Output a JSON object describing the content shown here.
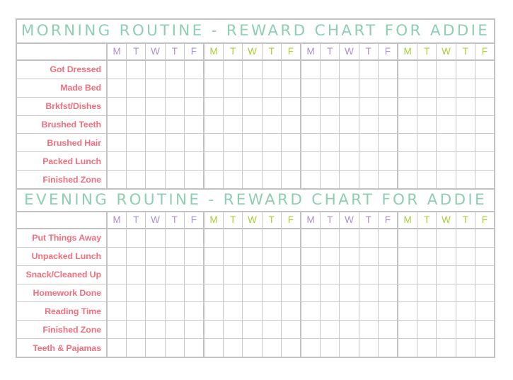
{
  "page": {
    "background_color": "#ffffff",
    "border_color": "#c2c2c2",
    "grid_line_color": "#c8c8c8"
  },
  "colors": {
    "title_green": "#8ecfb4",
    "label_pink": "#f2707e",
    "day_purple": "#ab8fd0",
    "day_green": "#a8d033"
  },
  "sections": [
    {
      "id": "morning",
      "title": "MORNING ROUTINE - REWARD CHART FOR ADDIE",
      "weeks": [
        {
          "index": 1,
          "color": "purple",
          "days": [
            "M",
            "T",
            "W",
            "T",
            "F"
          ]
        },
        {
          "index": 2,
          "color": "green",
          "days": [
            "M",
            "T",
            "W",
            "T",
            "F"
          ]
        },
        {
          "index": 3,
          "color": "purple",
          "days": [
            "M",
            "T",
            "W",
            "T",
            "F"
          ]
        },
        {
          "index": 4,
          "color": "green",
          "days": [
            "M",
            "T",
            "W",
            "T",
            "F"
          ]
        }
      ],
      "tasks": [
        "Got Dressed",
        "Made Bed",
        "Brkfst/Dishes",
        "Brushed Teeth",
        "Brushed Hair",
        "Packed Lunch",
        "Finished Zone"
      ]
    },
    {
      "id": "evening",
      "title": "EVENING ROUTINE - REWARD CHART FOR ADDIE",
      "weeks": [
        {
          "index": 1,
          "color": "purple",
          "days": [
            "M",
            "T",
            "W",
            "T",
            "F"
          ]
        },
        {
          "index": 2,
          "color": "green",
          "days": [
            "M",
            "T",
            "W",
            "T",
            "F"
          ]
        },
        {
          "index": 3,
          "color": "purple",
          "days": [
            "M",
            "T",
            "W",
            "T",
            "F"
          ]
        },
        {
          "index": 4,
          "color": "green",
          "days": [
            "M",
            "T",
            "W",
            "T",
            "F"
          ]
        }
      ],
      "tasks": [
        "Put Things Away",
        "Unpacked Lunch",
        "Snack/Cleaned Up",
        "Homework Done",
        "Reading Time",
        "Finished Zone",
        "Teeth & Pajamas"
      ]
    }
  ]
}
